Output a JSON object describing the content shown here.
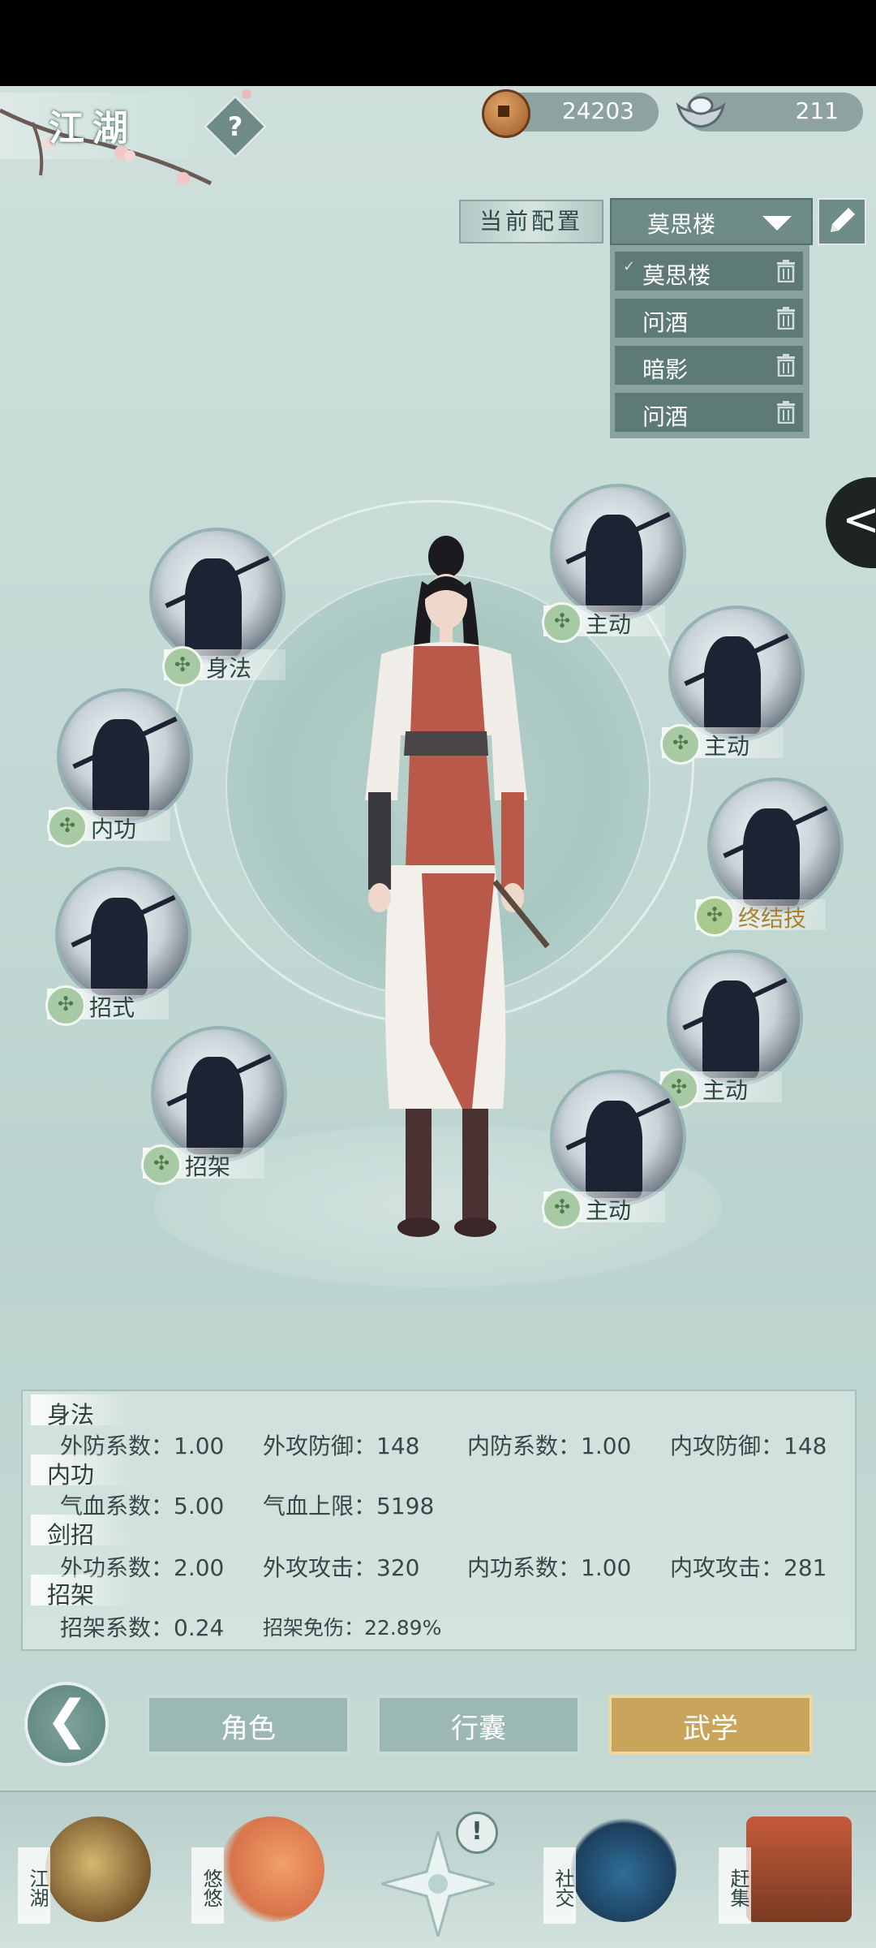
{
  "header": {
    "title": "江湖",
    "help_label": "?",
    "copper": "24203",
    "silver": "211"
  },
  "config": {
    "label": "当前配置",
    "selected": "莫思楼",
    "options": [
      "莫思楼",
      "问酒",
      "暗影",
      "问酒"
    ]
  },
  "side_tab": {
    "label": "<"
  },
  "skills": [
    {
      "label": "身法"
    },
    {
      "label": "内功"
    },
    {
      "label": "招式"
    },
    {
      "label": "招架"
    },
    {
      "label": "主动"
    },
    {
      "label": "主动"
    },
    {
      "label": "终结技"
    },
    {
      "label": "主动"
    },
    {
      "label": "主动"
    }
  ],
  "stats": {
    "shenfa": {
      "title": "身法",
      "items": [
        "外防系数：1.00",
        "外攻防御：148",
        "内防系数：1.00",
        "内攻防御：148"
      ]
    },
    "neigong": {
      "title": "内功",
      "items": [
        "气血系数：5.00",
        "气血上限：5198"
      ]
    },
    "jianzhao": {
      "title": "剑招",
      "items": [
        "外功系数：2.00",
        "外攻攻击：320",
        "内功系数：1.00",
        "内攻攻击：281"
      ]
    },
    "zhaojia": {
      "title": "招架",
      "items": [
        "招架系数：0.24",
        "招架免伤：22.89%"
      ]
    }
  },
  "tabs": {
    "role": "角色",
    "bag": "行囊",
    "martial": "武学",
    "active": "martial"
  },
  "bottom_nav": {
    "jianghu": "江湖",
    "youyou": "悠悠",
    "center_alert": "!",
    "social": "社交",
    "market": "赶集"
  },
  "colors": {
    "accent_gold": "#c9a45b",
    "panel_teal": "#6f8b86",
    "background": "#c4d9d5"
  }
}
